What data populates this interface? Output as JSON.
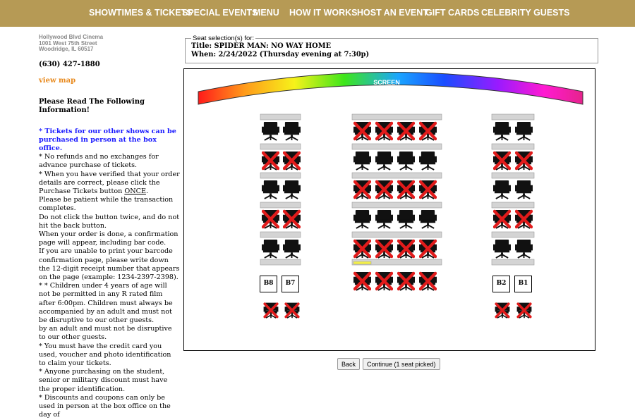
{
  "nav": {
    "items": [
      "SHOWTIMES & TICKETS",
      "SPECIAL EVENTS",
      "MENU",
      "HOW IT WORKS",
      "HOST AN EVENT",
      "GIFT CARDS",
      "CELEBRITY GUESTS"
    ]
  },
  "theater": {
    "name": "Hollywood Blvd Cinema",
    "street": "1001 West 75th Street",
    "city": "Woodridge, IL 60517",
    "phone": "(630) 427-1880",
    "map_link": "view map"
  },
  "info": {
    "title": "Please Read The Following Information!",
    "blue_note": "* Tickets for our other shows can be purchased in person at the box office.",
    "lines": [
      "* No refunds and no exchanges for advance purchase of tickets.",
      "* When you have verified that your order details are correct, please click the Purchase Tickets button",
      "Please be patient while the transaction completes.",
      "Do not click the button twice, and do not hit the back button.",
      "When your order is done, a confirmation page will appear, including bar code.",
      "If you are unable to print your barcode confirmation page, please write down the 12-digit receipt number that appears on the page (example: 1234-2397-2398).",
      "* * Children under 4 years of age will not be permitted in any R rated film after 6:00pm. Children must always be accompanied by an adult and must not be disruptive to our other guests.",
      "by an adult and must not be disruptive to our other guests.",
      "* You must have the credit card you used, voucher and photo identification to claim your tickets.",
      "* Anyone purchasing on the student, senior or military discount must have the proper identification.",
      "* Discounts and coupons can only be used in person at the box office on the day of"
    ],
    "once_word": "ONCE",
    "once_suffix": "."
  },
  "selection": {
    "legend": "Seat selection(s) for:",
    "title_line": "Title: SPIDER MAN: NO WAY HOME",
    "when_line": "When: 2/24/2022 (Thursday evening at 7:30p)"
  },
  "screen_label": "SCREEN",
  "seat_labels": {
    "b8": "B8",
    "b7": "B7",
    "b2": "B2",
    "b1": "B1"
  },
  "colors": {
    "nav_bg": "#b69a55",
    "taken_x": "#e11b1b",
    "selected_bar": "#f2ee4a",
    "map_link": "#e8891c",
    "note_blue": "#1a1aff"
  },
  "seating": {
    "left_rows": [
      [
        0,
        0
      ],
      [
        1,
        1
      ],
      [
        0,
        0
      ],
      [
        1,
        1
      ],
      [
        0,
        0
      ],
      [
        0,
        0
      ]
    ],
    "center_rows": [
      [
        1,
        1,
        1,
        1
      ],
      [
        0,
        0,
        0,
        0
      ],
      [
        1,
        1,
        1,
        1
      ],
      [
        0,
        0,
        0,
        0
      ],
      [
        1,
        1,
        1,
        1
      ],
      [
        0,
        0,
        0,
        0
      ]
    ],
    "right_rows": [
      [
        0,
        0
      ],
      [
        1,
        1
      ],
      [
        0,
        0
      ],
      [
        1,
        1
      ],
      [
        0,
        0
      ],
      [
        0,
        0
      ]
    ],
    "center_row7": [
      1,
      1,
      1,
      1
    ],
    "bottom_left": [
      1,
      1
    ],
    "bottom_right": [
      1,
      1
    ]
  },
  "buttons": {
    "back": "Back",
    "continue": "Continue (1 seat picked)"
  }
}
